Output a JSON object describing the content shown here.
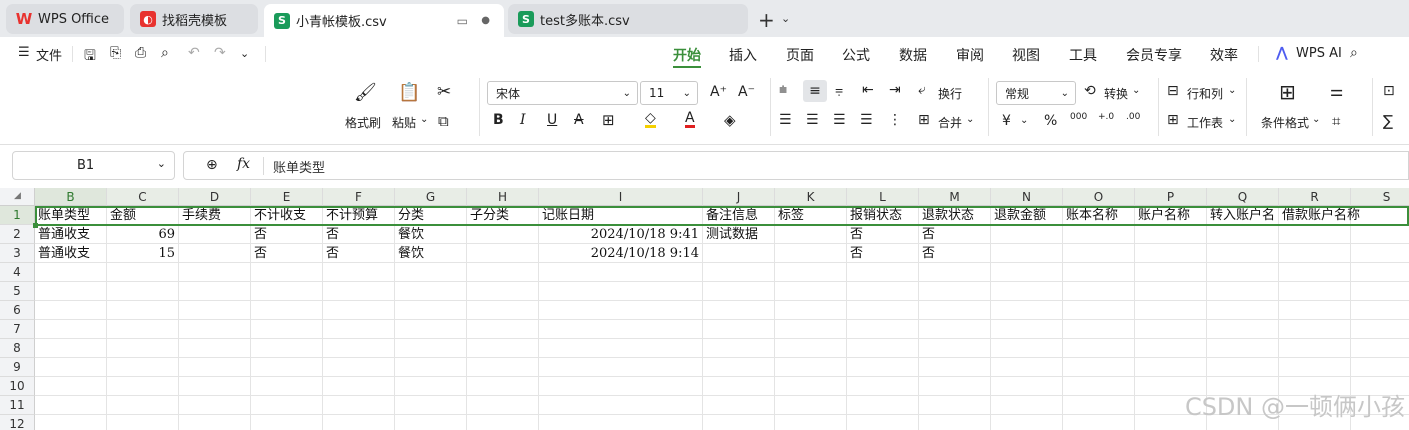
{
  "tabs": [
    {
      "label": "WPS Office",
      "icon": "wps-logo-icon"
    },
    {
      "label": "找稻壳模板",
      "icon": "daoke-icon"
    },
    {
      "label": "小青帐模板.csv",
      "icon": "spreadsheet-icon"
    },
    {
      "label": "test多账本.csv",
      "icon": "spreadsheet-icon"
    }
  ],
  "menubar": {
    "file_label": "文件",
    "menus": [
      "开始",
      "插入",
      "页面",
      "公式",
      "数据",
      "审阅",
      "视图",
      "工具",
      "会员专享",
      "效率"
    ],
    "active_menu": "开始",
    "ai_label": "WPS AI"
  },
  "ribbon": {
    "format_painter": "格式刷",
    "paste": "粘贴",
    "font_name": "宋体",
    "font_size": "11",
    "wrap": "换行",
    "merge": "合并",
    "number_format": "常规",
    "convert": "转换",
    "rows_cols": "行和列",
    "worksheet": "工作表",
    "cond_format": "条件格式",
    "currency": "¥",
    "percent": "%",
    "thousands": "000",
    "inc_dec": "+.0",
    "dec_dec": ".00"
  },
  "formula": {
    "namebox": "B1",
    "fx": "fx",
    "content": "账单类型"
  },
  "sheet": {
    "columns": [
      "B",
      "C",
      "D",
      "E",
      "F",
      "G",
      "H",
      "I",
      "J",
      "K",
      "L",
      "M",
      "N",
      "O",
      "P",
      "Q",
      "R",
      "S"
    ],
    "row_numbers": [
      "1",
      "2",
      "3",
      "4",
      "5",
      "6",
      "7",
      "8",
      "9",
      "10",
      "11",
      "12"
    ],
    "header_row": [
      "账单类型",
      "金额",
      "手续费",
      "不计收支",
      "不计预算",
      "分类",
      "子分类",
      "记账日期",
      "备注信息",
      "标签",
      "报销状态",
      "退款状态",
      "退款金额",
      "账本名称",
      "账户名称",
      "转入账户名",
      "借款账户名称",
      ""
    ],
    "rows": [
      [
        "普通收支",
        "69",
        "",
        "否",
        "否",
        "餐饮",
        "",
        "2024/10/18 9:41",
        "测试数据",
        "",
        "否",
        "否",
        "",
        "",
        "",
        "",
        "",
        ""
      ],
      [
        "普通收支",
        "15",
        "",
        "否",
        "否",
        "餐饮",
        "",
        "2024/10/18 9:14",
        "",
        "",
        "否",
        "否",
        "",
        "",
        "",
        "",
        "",
        ""
      ]
    ]
  },
  "watermark": "CSDN @一顿俩小孩",
  "colors": {
    "accent": "#3b8f3b",
    "wps_red": "#e8322f",
    "sheet_green": "#1a9b5a"
  }
}
